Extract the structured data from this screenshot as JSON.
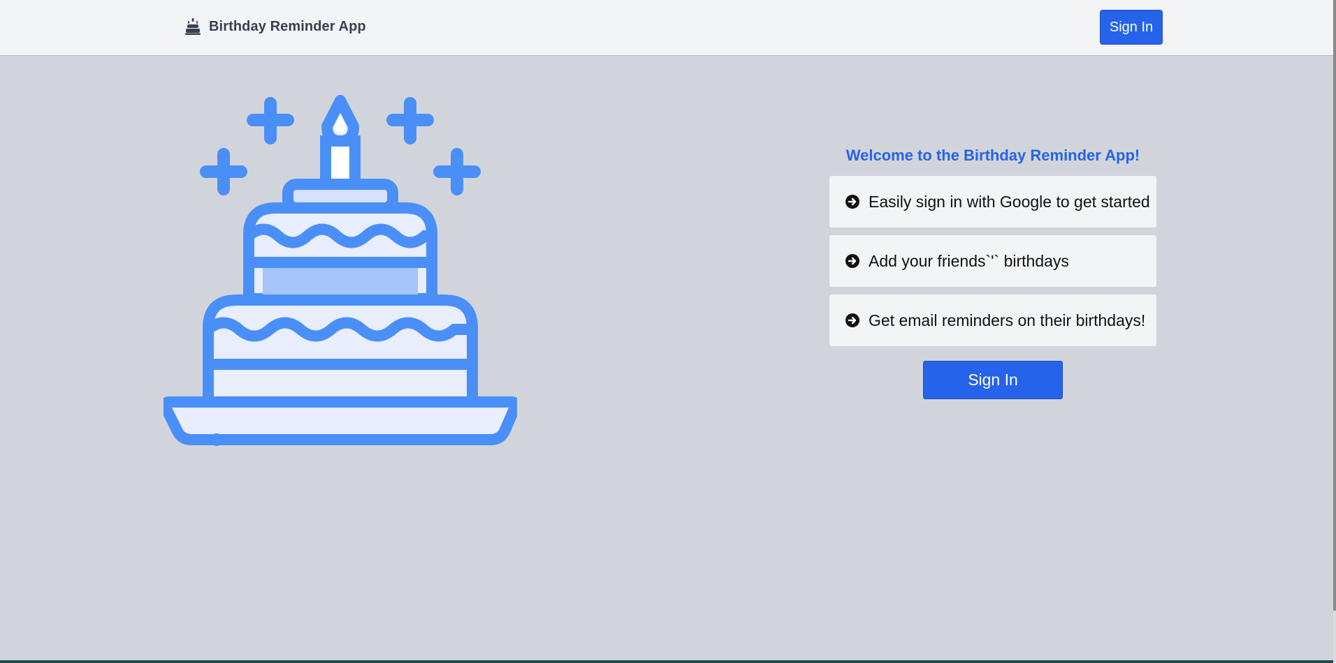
{
  "navbar": {
    "brand": "Birthday Reminder App",
    "brand_icon": "cake-icon",
    "signin_label": "Sign In"
  },
  "hero": {
    "illustration": "birthday-cake-icon",
    "accent_color": "#4a8ff8"
  },
  "welcome": {
    "title": "Welcome to the Birthday Reminder App!",
    "features": [
      {
        "icon": "arrow-circle-right-icon",
        "text": "Easily sign in with Google to get started"
      },
      {
        "icon": "arrow-circle-right-icon",
        "text": "Add your friends`'` birthdays"
      },
      {
        "icon": "arrow-circle-right-icon",
        "text": "Get email reminders on their birthdays!"
      }
    ],
    "signin_label": "Sign In"
  },
  "colors": {
    "primary": "#2563eb",
    "background": "#d1d5db",
    "navbar_bg": "#f3f4f6",
    "card_bg": "#f3f4f6"
  }
}
